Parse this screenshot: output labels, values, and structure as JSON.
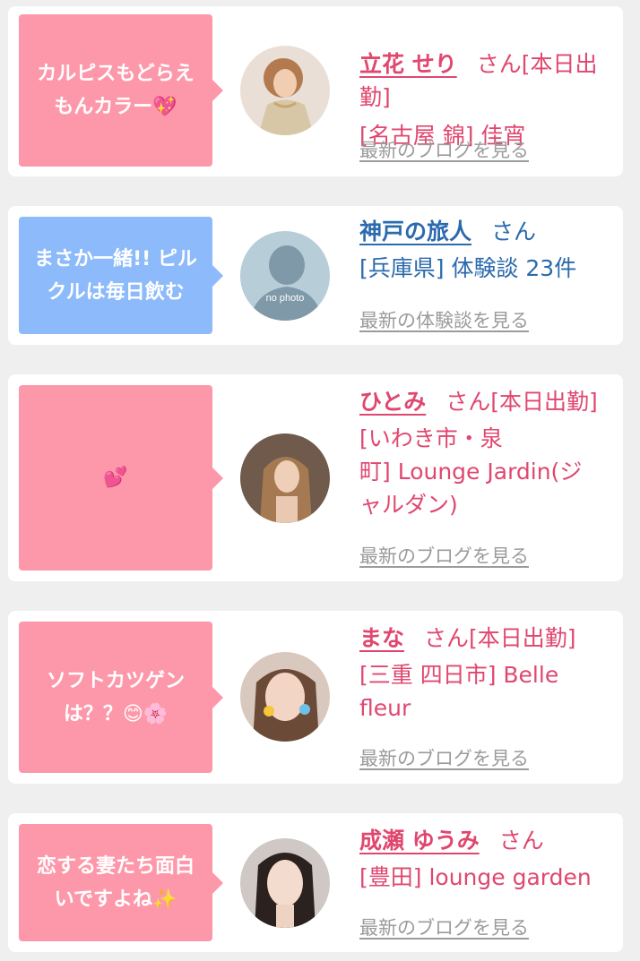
{
  "cards": [
    {
      "comment": "カルピスもどらえ\nもんカラー💖",
      "name": "立花 せり",
      "suffix": "さん[本日出\n勤]",
      "detail": "[名古屋 錦] 佳宵",
      "link": "最新のブログを見る",
      "bubble_color": "#fd98aa"
    },
    {
      "comment": "まさか一緒!! ピル\nクルは毎日飲む",
      "name": "神戸の旅人",
      "suffix": "さん",
      "detail": "[兵庫県] 体験談 23件",
      "link": "最新の体験談を見る",
      "avatar_text": "no photo",
      "bubble_color": "#8cbafa"
    },
    {
      "comment": "💕",
      "name": "ひとみ",
      "suffix": "さん[本日出勤]",
      "detail": "[いわき市・泉\n町] Lounge Jardin(ジ\nャルダン)",
      "link": "最新のブログを見る",
      "bubble_color": "#fd98aa"
    },
    {
      "comment": "ソフトカツゲン\nは？？😊🌸",
      "name": "まな",
      "suffix": "さん[本日出勤]",
      "detail": "[三重 四日市] Belle\nfleur",
      "link": "最新のブログを見る",
      "bubble_color": "#fd98aa"
    },
    {
      "comment": "恋する妻たち面白\nいですよね✨",
      "name": "成瀬 ゆうみ",
      "suffix": "さん",
      "detail": "[豊田] lounge garden",
      "link": "最新のブログを見る",
      "bubble_color": "#fd98aa"
    }
  ]
}
